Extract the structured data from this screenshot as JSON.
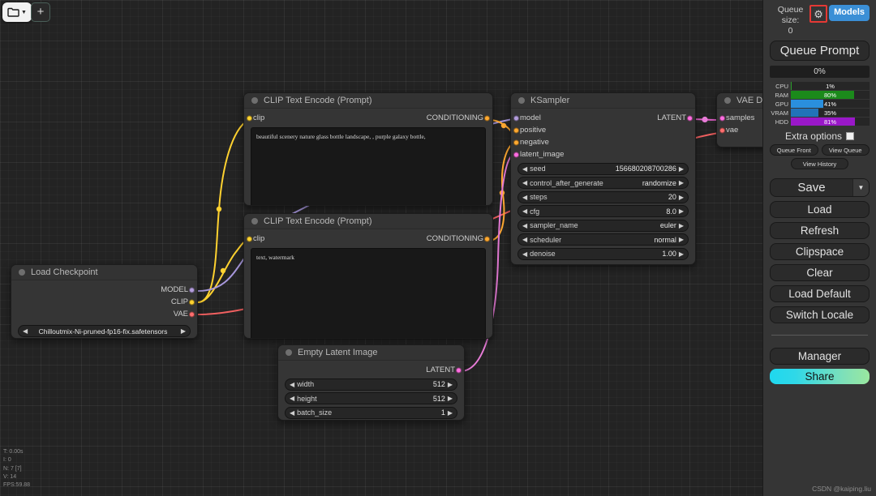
{
  "toolbar": {
    "folder_icon": "folder-icon",
    "folder_caret": "▼",
    "add_label": "+"
  },
  "canvas": {
    "nodes": [
      {
        "id": "clip_positive",
        "title": "CLIP Text Encode (Prompt)",
        "inputs": [
          {
            "name": "clip",
            "color": "#FFD230"
          }
        ],
        "outputs": [
          {
            "name": "CONDITIONING",
            "color": "#FFA931"
          }
        ],
        "text": "beautiful scenery nature glass bottle landscape, , purple galaxy bottle,"
      },
      {
        "id": "clip_negative",
        "title": "CLIP Text Encode (Prompt)",
        "inputs": [
          {
            "name": "clip",
            "color": "#FFD230"
          }
        ],
        "outputs": [
          {
            "name": "CONDITIONING",
            "color": "#FFA931"
          }
        ],
        "text": "text, watermark"
      },
      {
        "id": "ksampler",
        "title": "KSampler",
        "inputs": [
          {
            "name": "model",
            "color": "#B39DDB"
          },
          {
            "name": "positive",
            "color": "#FFA931"
          },
          {
            "name": "negative",
            "color": "#FFA931"
          },
          {
            "name": "latent_image",
            "color": "#FF6EE0"
          }
        ],
        "outputs": [
          {
            "name": "LATENT",
            "color": "#FF6EE0"
          }
        ],
        "widgets": [
          {
            "name": "seed",
            "value": "156680208700286"
          },
          {
            "name": "control_after_generate",
            "value": "randomize"
          },
          {
            "name": "steps",
            "value": "20"
          },
          {
            "name": "cfg",
            "value": "8.0"
          },
          {
            "name": "sampler_name",
            "value": "euler"
          },
          {
            "name": "scheduler",
            "value": "normal"
          },
          {
            "name": "denoise",
            "value": "1.00"
          }
        ]
      },
      {
        "id": "load_checkpoint",
        "title": "Load Checkpoint",
        "outputs": [
          {
            "name": "MODEL",
            "color": "#B39DDB"
          },
          {
            "name": "CLIP",
            "color": "#FFD230"
          },
          {
            "name": "VAE",
            "color": "#FF6E6E"
          }
        ],
        "widgets": [
          {
            "name": "ckpt_name",
            "value": "Chilloutmix-Ni-pruned-fp16-fix.safetensors"
          }
        ]
      },
      {
        "id": "empty_latent",
        "title": "Empty Latent Image",
        "outputs": [
          {
            "name": "LATENT",
            "color": "#FF6EE0"
          }
        ],
        "widgets": [
          {
            "name": "width",
            "value": "512"
          },
          {
            "name": "height",
            "value": "512"
          },
          {
            "name": "batch_size",
            "value": "1"
          }
        ]
      },
      {
        "id": "vae_decode",
        "title": "VAE Dec",
        "inputs": [
          {
            "name": "samples",
            "color": "#FF6EE0"
          },
          {
            "name": "vae",
            "color": "#FF6E6E"
          }
        ]
      }
    ],
    "arrow_left": "◀",
    "arrow_right": "▶"
  },
  "panel": {
    "queue_size_label": "Queue size:",
    "queue_size_value": "0",
    "gear_icon": "⚙",
    "models_label": "Models",
    "queue_prompt_label": "Queue Prompt",
    "progress_text": "0%",
    "resources": [
      {
        "label": "CPU",
        "value": "1%",
        "pct": 1,
        "color": "#2a9d2a"
      },
      {
        "label": "RAM",
        "value": "80%",
        "pct": 80,
        "color": "#1b8a1b"
      },
      {
        "label": "GPU",
        "value": "41%",
        "pct": 41,
        "color": "#2a8fdd"
      },
      {
        "label": "VRAM",
        "value": "35%",
        "pct": 35,
        "color": "#2273b8"
      },
      {
        "label": "HDD",
        "value": "81%",
        "pct": 81,
        "color": "#9a18c9"
      }
    ],
    "extra_options_label": "Extra options",
    "queue_front_label": "Queue Front",
    "view_queue_label": "View Queue",
    "view_history_label": "View History",
    "save_label": "Save",
    "save_caret": "▼",
    "load_label": "Load",
    "refresh_label": "Refresh",
    "clipspace_label": "Clipspace",
    "clear_label": "Clear",
    "load_default_label": "Load Default",
    "switch_locale_label": "Switch Locale",
    "manager_label": "Manager",
    "share_label": "Share"
  },
  "stats": {
    "time": "T: 0.00s",
    "iterations": "I: 0",
    "nodes": "N: 7 [7]",
    "version": "V: 14",
    "fps": "FPS:59.88"
  },
  "watermark": "CSDN @kaiping.liu"
}
